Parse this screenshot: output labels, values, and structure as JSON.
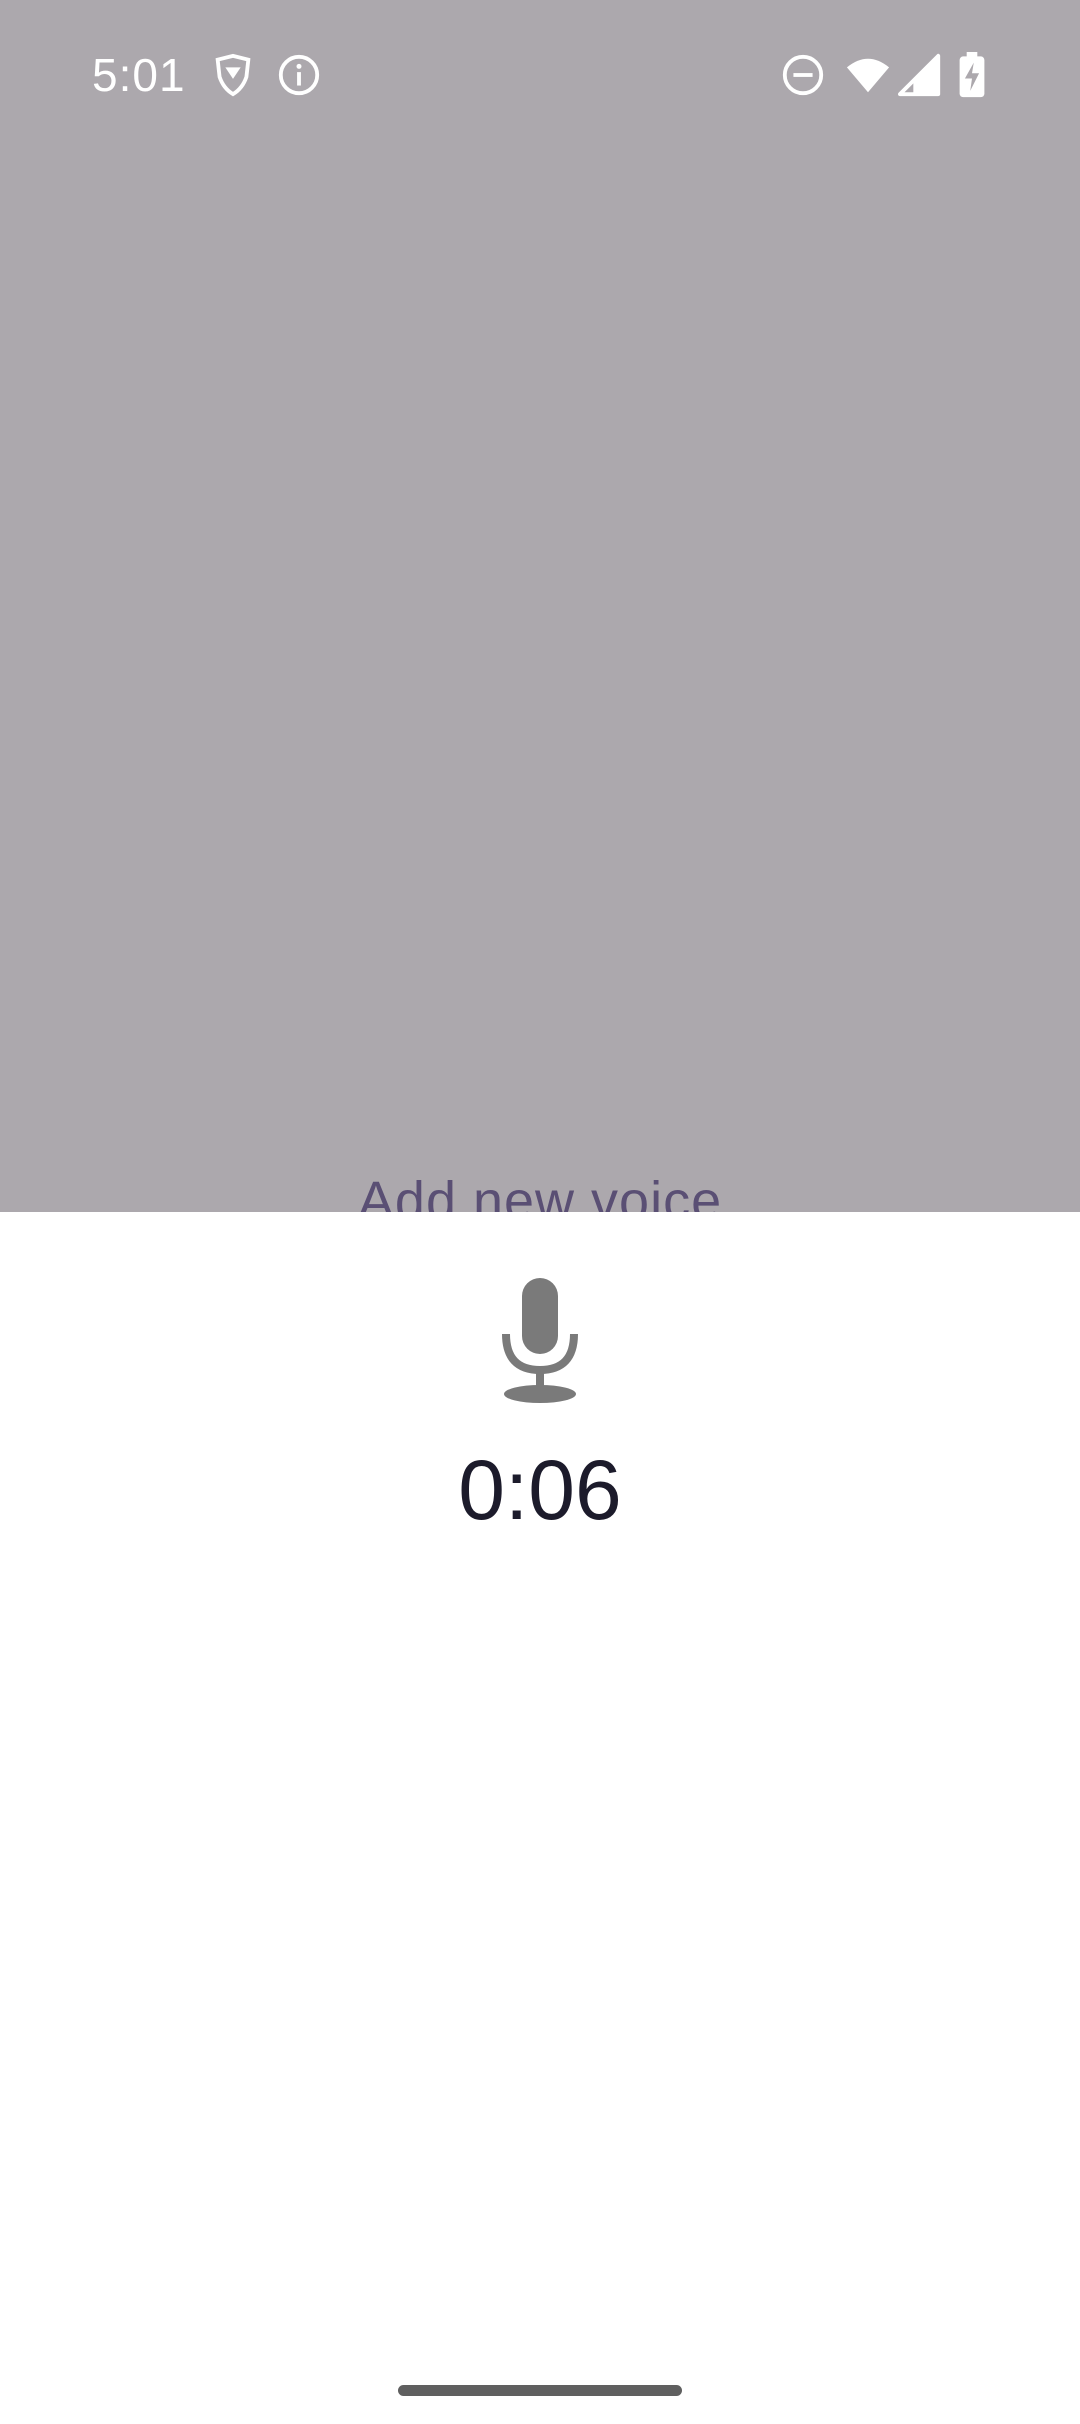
{
  "status_bar": {
    "time": "5:01",
    "icons": [
      "brave-shield-icon",
      "info-icon",
      "do-not-disturb-icon",
      "wifi-icon",
      "cell-signal-icon",
      "battery-charging-icon"
    ]
  },
  "background_screen": {
    "partial_text": "Add new voice"
  },
  "recording_sheet": {
    "icon": "microphone-icon",
    "elapsed_time": "0:06"
  },
  "colors": {
    "scrim": "#aca8ad",
    "sheet": "#ffffff",
    "timer_text": "#1c1b2b",
    "mic_icon": "#7a7a7a",
    "nav_handle": "#5f5f5f"
  }
}
